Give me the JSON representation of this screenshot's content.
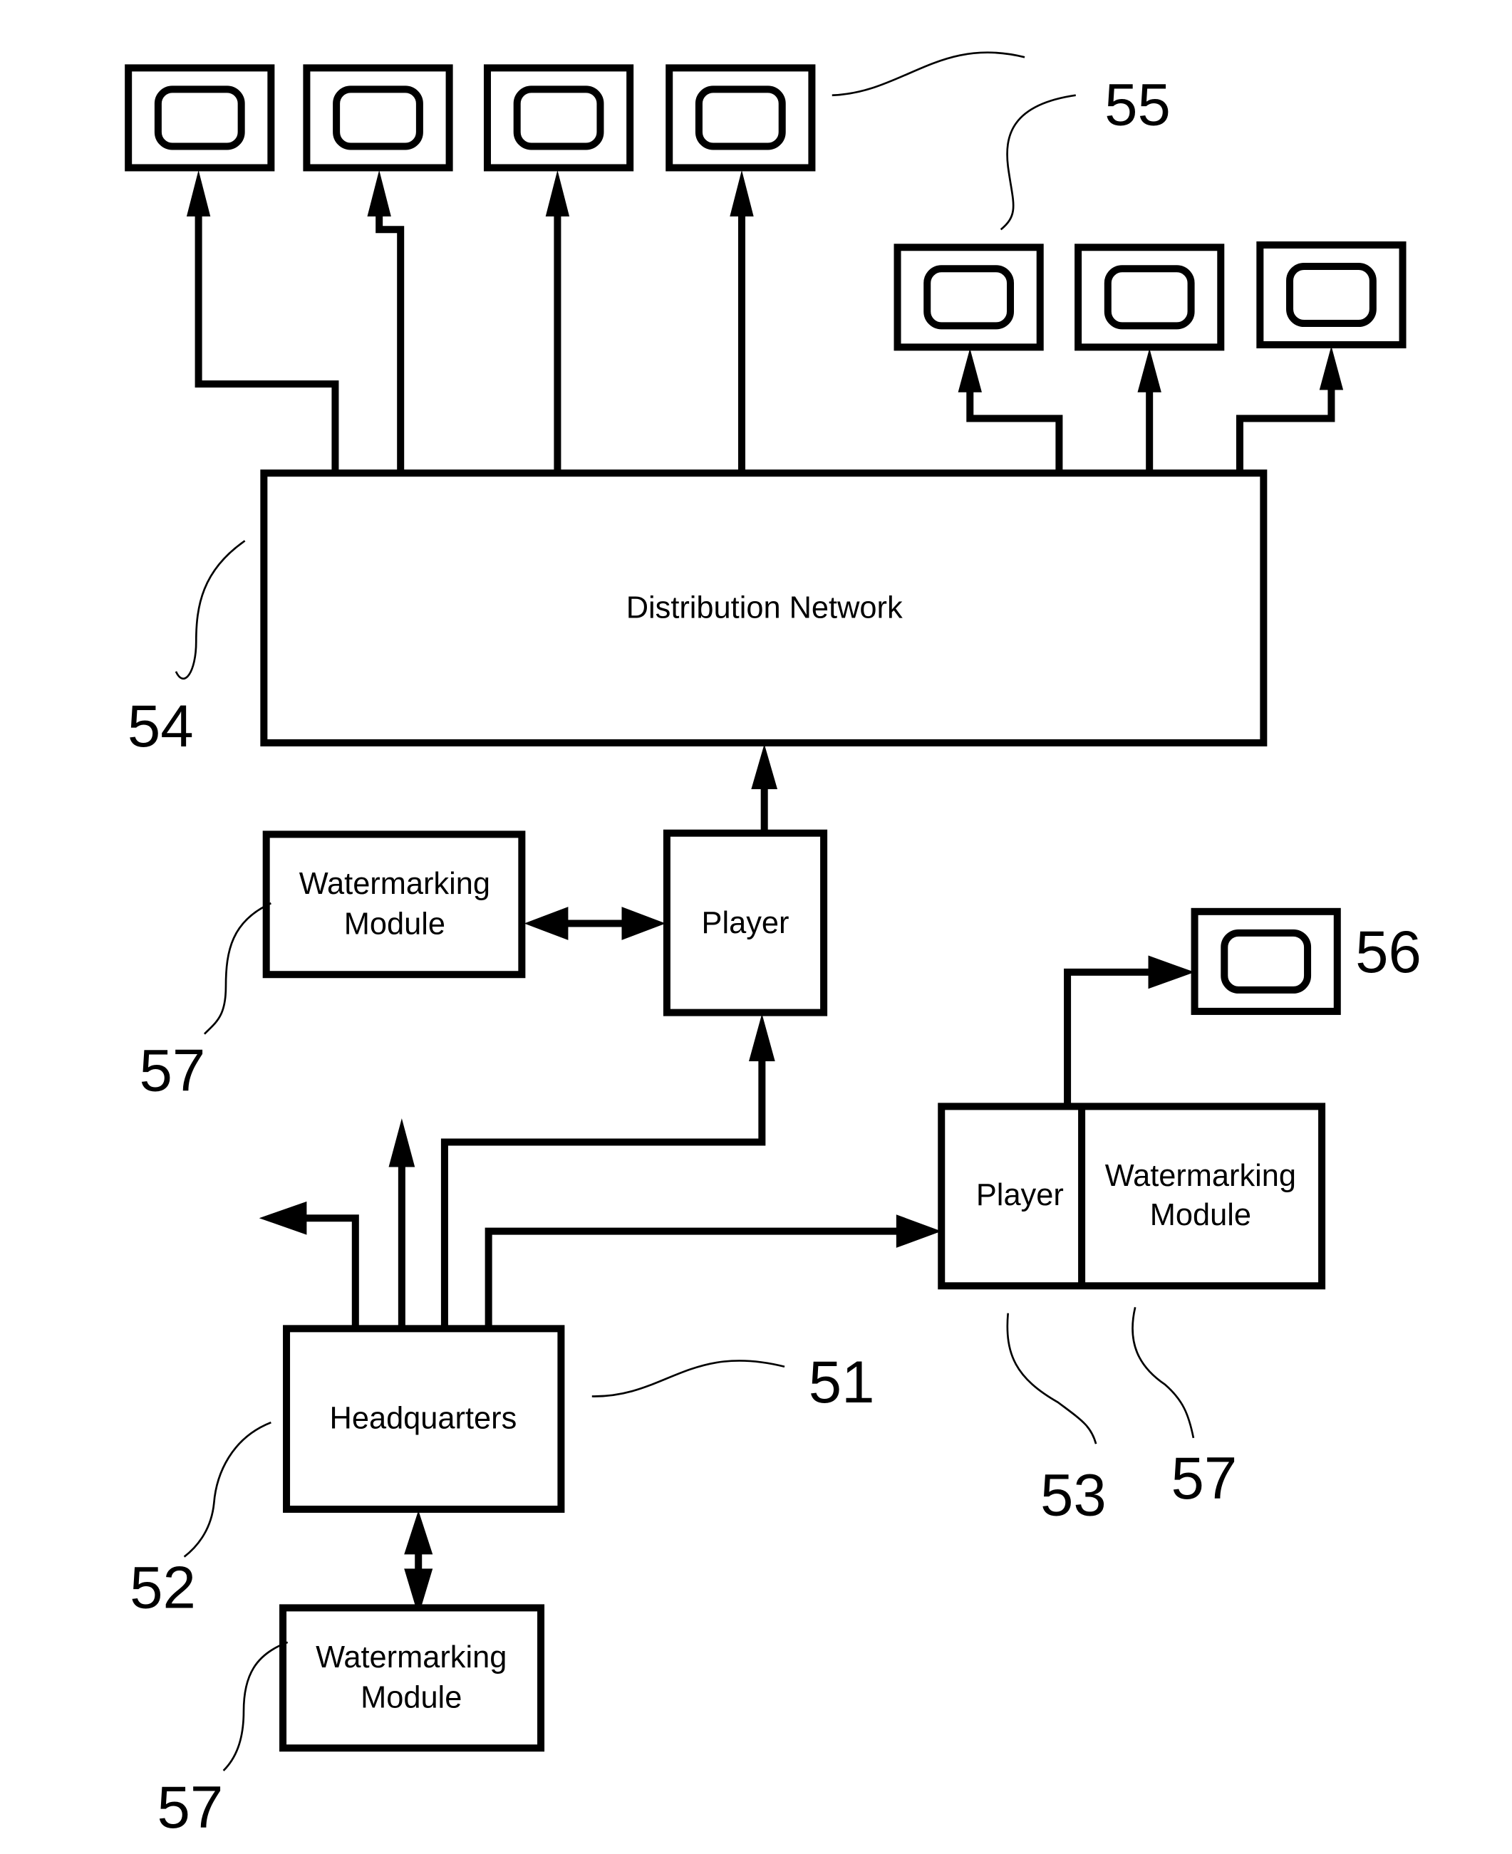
{
  "diagram": {
    "type": "block-diagram",
    "nodes": {
      "distribution_network": {
        "label": "Distribution Network"
      },
      "player_top": {
        "label": "Player"
      },
      "watermarking_top": {
        "line1": "Watermarking",
        "line2": "Module"
      },
      "headquarters": {
        "label": "Headquarters"
      },
      "watermarking_bottom": {
        "line1": "Watermarking",
        "line2": "Module"
      },
      "player_combo": {
        "label": "Player"
      },
      "watermarking_combo": {
        "line1": "Watermarking",
        "line2": "Module"
      }
    },
    "displays": {
      "top_group_count": 4,
      "right_group_count": 3,
      "standalone_count": 1
    },
    "reference_numerals": {
      "r51": "51",
      "r52": "52",
      "r53": "53",
      "r54": "54",
      "r55": "55",
      "r56": "56",
      "r57_top": "57",
      "r57_right": "57",
      "r57_bottom": "57"
    },
    "edges": [
      {
        "from": "Distribution Network",
        "to": "Display (top group)",
        "count": 4
      },
      {
        "from": "Distribution Network",
        "to": "Display (right group)",
        "count": 3
      },
      {
        "from": "Player",
        "to": "Distribution Network"
      },
      {
        "from": "Watermarking Module",
        "to": "Player",
        "bidirectional": true
      },
      {
        "from": "Headquarters",
        "to": "Player"
      },
      {
        "from": "Headquarters",
        "to": "Player / Watermarking Module"
      },
      {
        "from": "Headquarters",
        "to": "(outgoing, up)"
      },
      {
        "from": "Headquarters",
        "to": "(outgoing, left)"
      },
      {
        "from": "Headquarters",
        "to": "Watermarking Module",
        "bidirectional": true
      },
      {
        "from": "Player / Watermarking Module",
        "to": "Display 56"
      }
    ]
  }
}
